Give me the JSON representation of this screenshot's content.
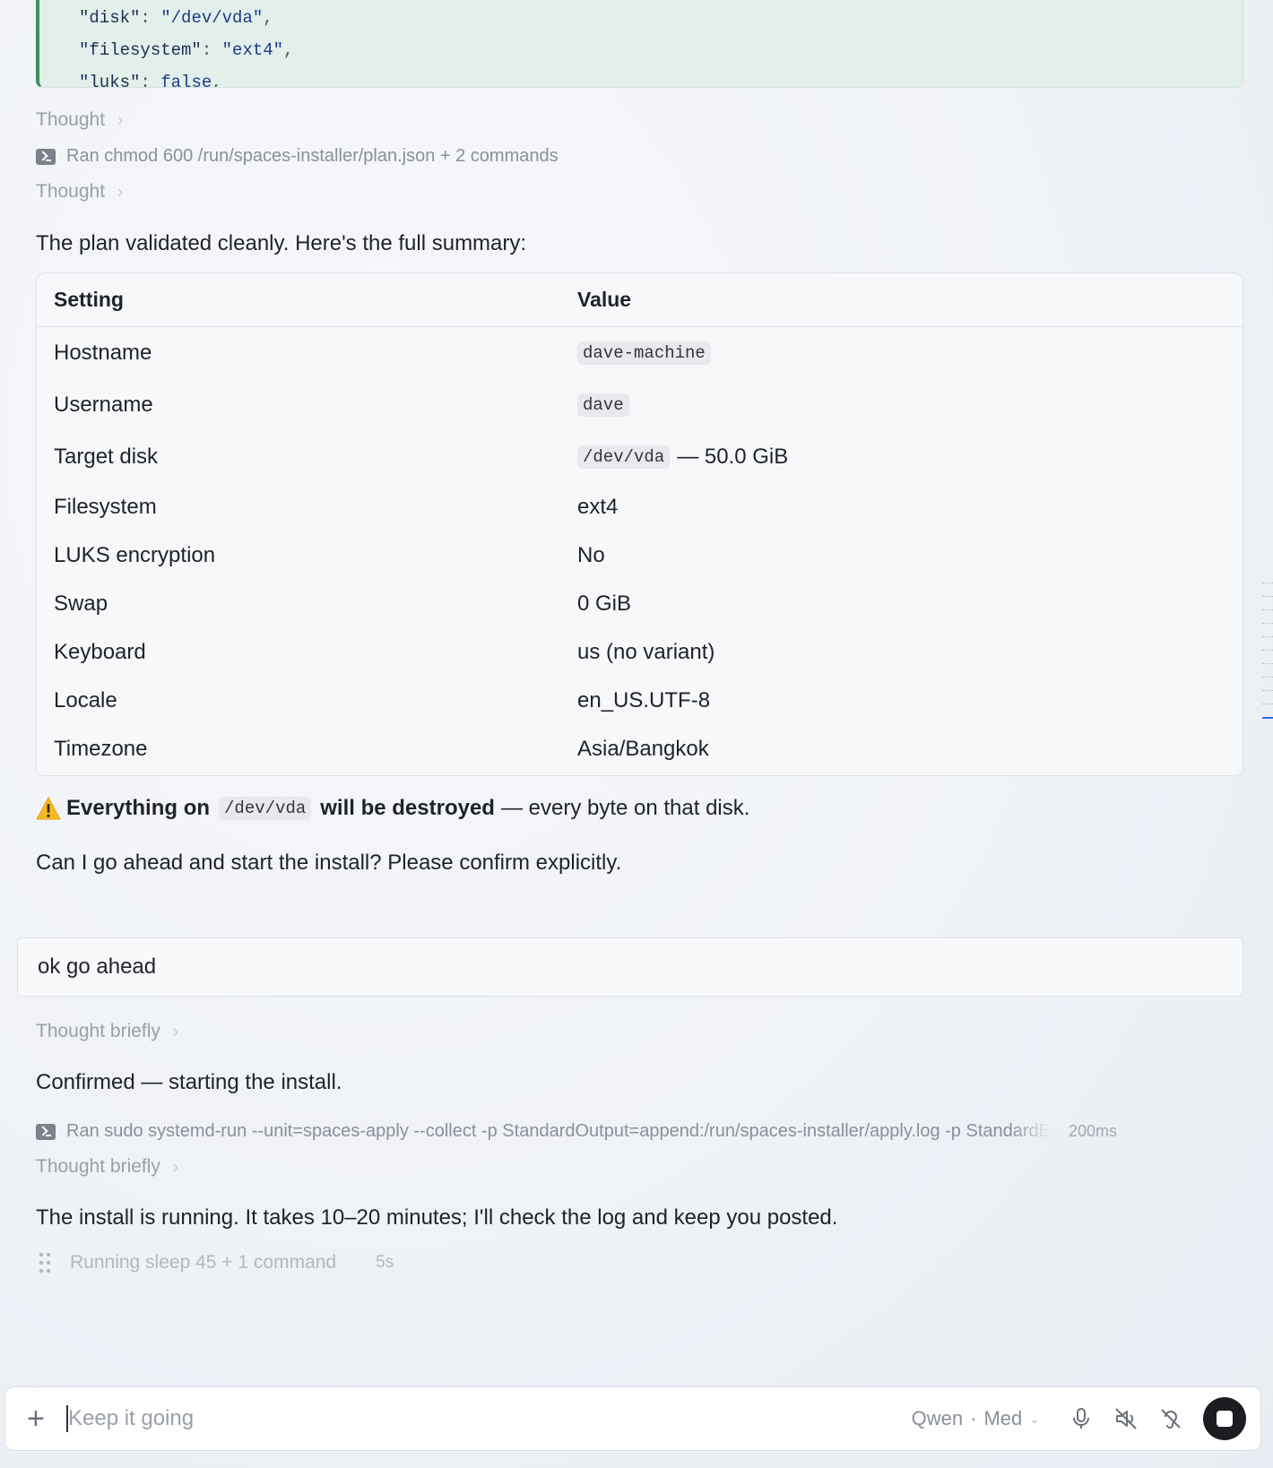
{
  "code": {
    "lines": [
      {
        "key": "\"disk\"",
        "val": "\"/dev/vda\"",
        "tail": ","
      },
      {
        "key": "\"filesystem\"",
        "val": "\"ext4\"",
        "tail": ","
      },
      {
        "key": "\"luks\"",
        "val": "false",
        "tail": ","
      }
    ]
  },
  "thought_1": "Thought",
  "cmd_1": "Ran chmod 600 /run/spaces-installer/plan.json + 2 commands",
  "thought_2": "Thought",
  "intro": "The plan validated cleanly. Here's the full summary:",
  "table": {
    "headers": [
      "Setting",
      "Value"
    ],
    "rows": [
      {
        "setting": "Hostname",
        "chip": "dave-machine",
        "text": ""
      },
      {
        "setting": "Username",
        "chip": "dave",
        "text": ""
      },
      {
        "setting": "Target disk",
        "chip": "/dev/vda",
        "text": "— 50.0 GiB"
      },
      {
        "setting": "Filesystem",
        "chip": "",
        "text": "ext4"
      },
      {
        "setting": "LUKS encryption",
        "chip": "",
        "text": "No"
      },
      {
        "setting": "Swap",
        "chip": "",
        "text": "0 GiB"
      },
      {
        "setting": "Keyboard",
        "chip": "",
        "text": "us (no variant)"
      },
      {
        "setting": "Locale",
        "chip": "",
        "text": "en_US.UTF-8"
      },
      {
        "setting": "Timezone",
        "chip": "",
        "text": "Asia/Bangkok"
      }
    ]
  },
  "warning": {
    "bold_pre": "Everything on",
    "chip": "/dev/vda",
    "bold_post": "will be destroyed",
    "rest": "— every byte on that disk."
  },
  "confirm_q": "Can I go ahead and start the install? Please confirm explicitly.",
  "user_msg": "ok go ahead",
  "thought_3": "Thought briefly",
  "confirmed": "Confirmed — starting the install.",
  "cmd_2": "Ran sudo systemd-run --unit=spaces-apply --collect -p StandardOutput=append:/run/spaces-installer/apply.log -p StandardE",
  "cmd_2_time": "200ms",
  "thought_4": "Thought briefly",
  "running_msg": "The install is running. It takes 10–20 minutes; I'll check the log and keep you posted.",
  "running_cmd": "Running sleep 45 + 1 command",
  "running_time": "5s",
  "composer": {
    "placeholder": "Keep it going",
    "model": "Qwen",
    "effort": "Med"
  }
}
